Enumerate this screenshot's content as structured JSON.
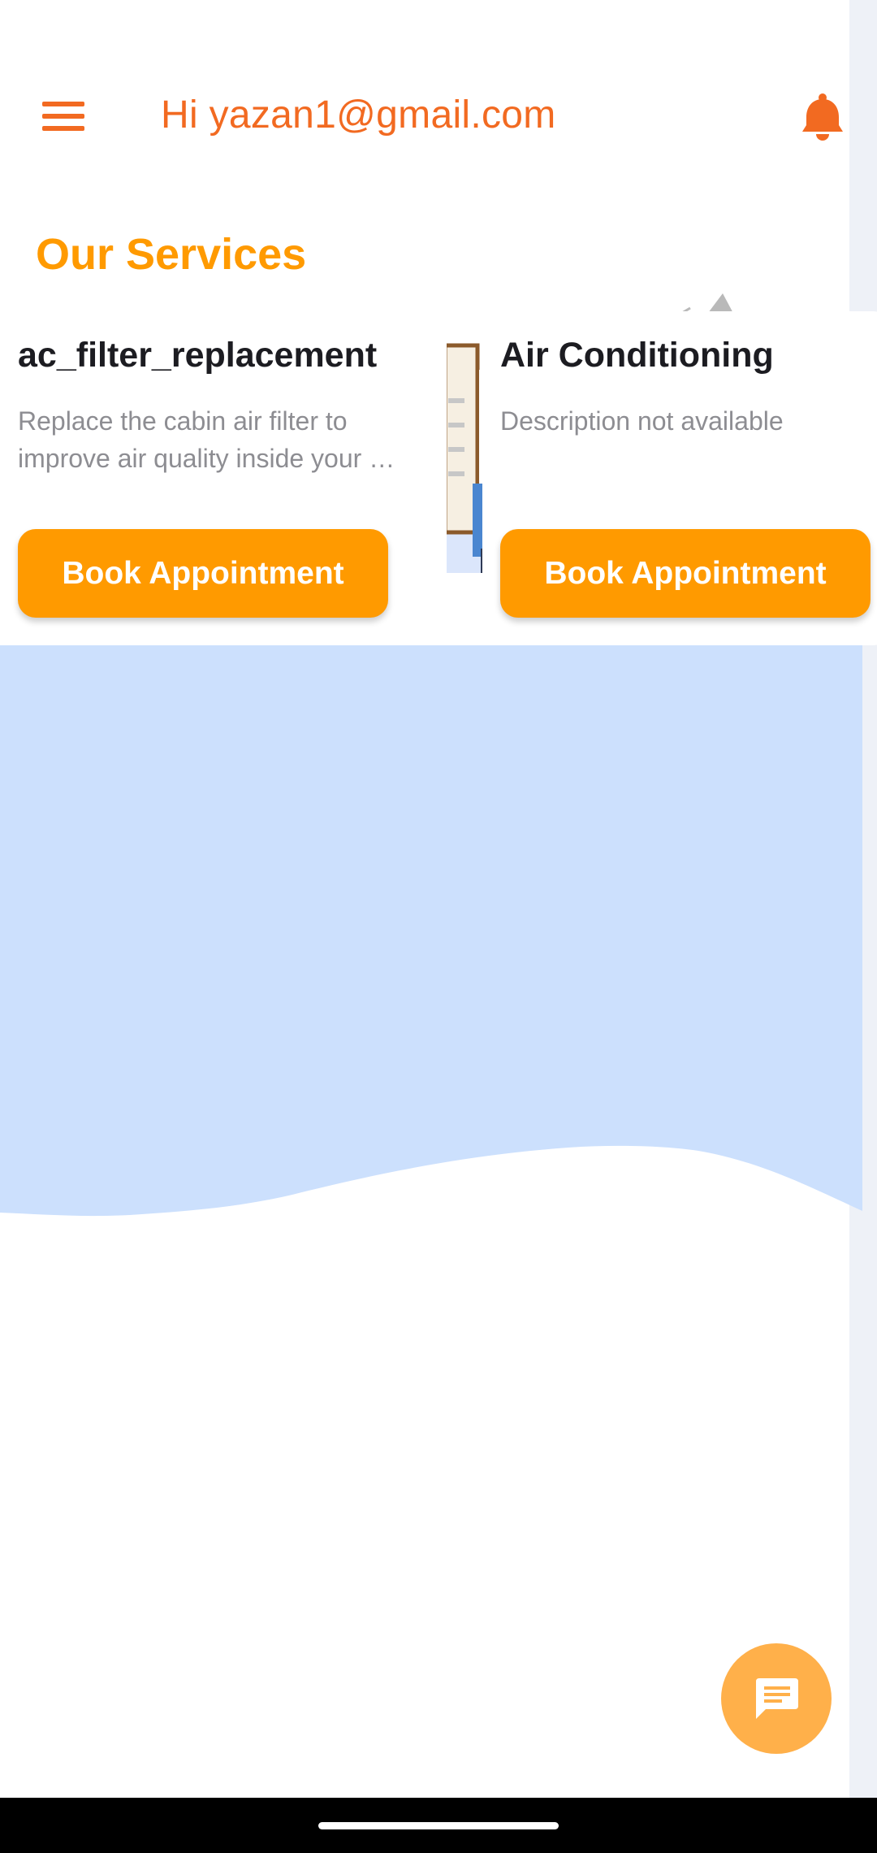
{
  "header": {
    "greeting": "Hi yazan1@gmail.com",
    "menu_icon": "hamburger-menu-icon",
    "notification_icon": "bell-icon",
    "accent_color": "#f26a21"
  },
  "services": {
    "title": "Our Services",
    "cards": [
      {
        "title": "ac_filter_replacement",
        "description_lines": [
          "Replace the cabin air filter to",
          "improve air quality inside your …"
        ],
        "button_label": "Book Appointment"
      },
      {
        "title": "Air Conditioning",
        "description": "Description not available",
        "button_label": "Book Appointment"
      }
    ]
  },
  "fab": {
    "icon": "chat-icon"
  },
  "colors": {
    "primary": "#ff9a00",
    "fab": "#ffb04a",
    "wave": "#cce0fd",
    "title_text": "#1c1c21",
    "description_text": "#8d8d92"
  },
  "system_nav": {
    "handle": "home-indicator"
  }
}
